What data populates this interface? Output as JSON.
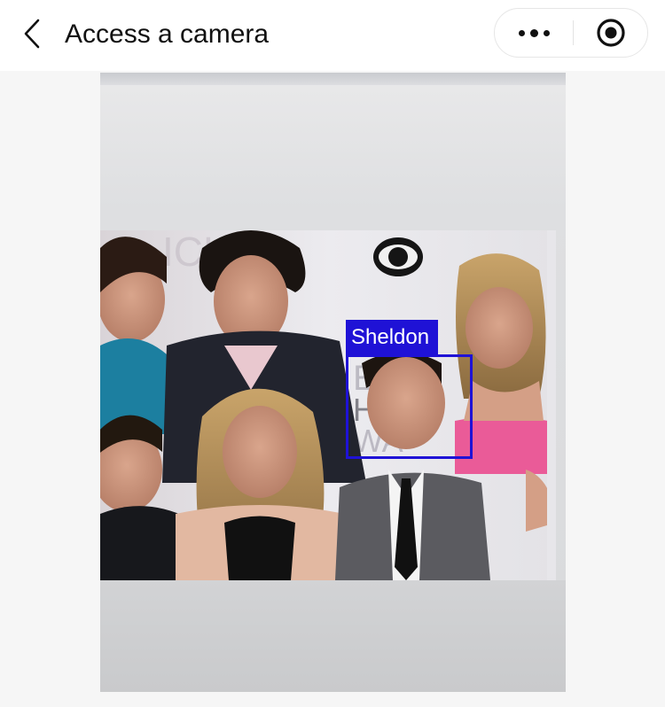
{
  "header": {
    "title": "Access a camera",
    "back_icon": "chevron-left-icon",
    "more_icon": "more-dots-icon",
    "close_icon": "target-circle-icon"
  },
  "camera": {
    "detection": {
      "label": "Sheldon",
      "color": "#1f12d6"
    }
  },
  "colors": {
    "header_bg": "#ffffff",
    "page_bg": "#f6f6f6",
    "detection_box": "#1f12d6"
  }
}
